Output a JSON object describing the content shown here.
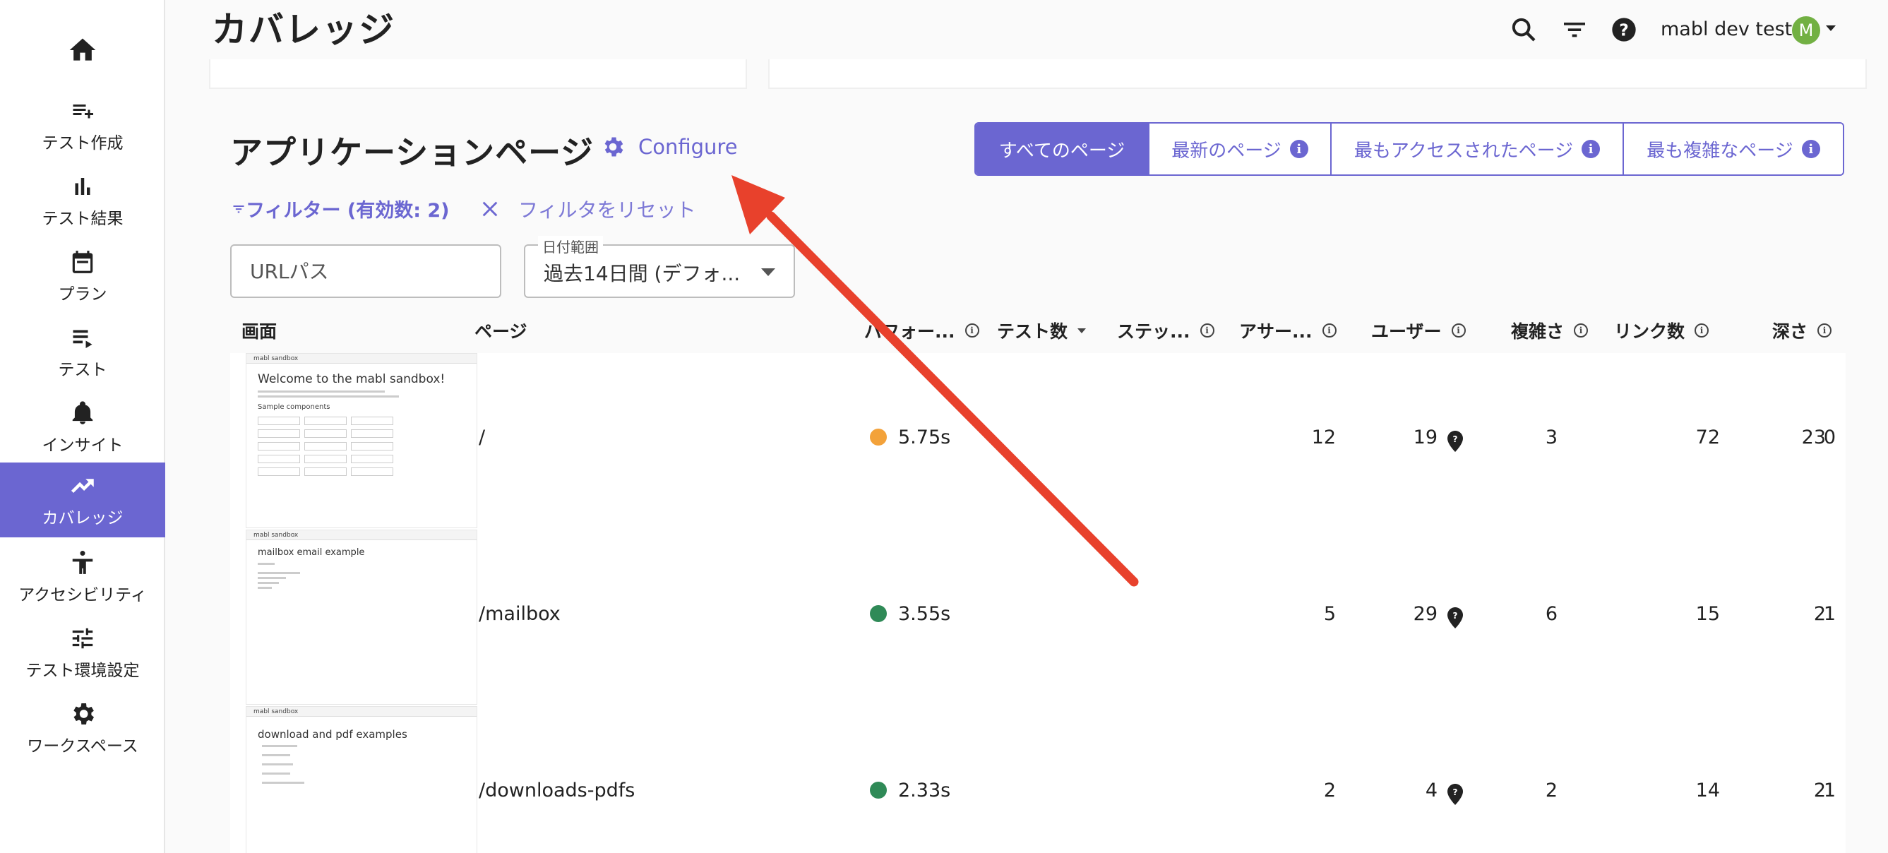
{
  "sidebar": {
    "items": [
      {
        "label": "",
        "icon": "home-icon"
      },
      {
        "label": "テスト作成",
        "icon": "playlist-add-icon"
      },
      {
        "label": "テスト結果",
        "icon": "bar-chart-icon"
      },
      {
        "label": "プラン",
        "icon": "calendar-icon"
      },
      {
        "label": "テスト",
        "icon": "list-icon"
      },
      {
        "label": "インサイト",
        "icon": "bell-icon"
      },
      {
        "label": "カバレッジ",
        "icon": "trending-up-icon"
      },
      {
        "label": "アクセシビリティ",
        "icon": "accessibility-icon"
      },
      {
        "label": "テスト環境設定",
        "icon": "tune-icon"
      },
      {
        "label": "ワークスペース",
        "icon": "gear-icon"
      }
    ],
    "active_index": 6,
    "accent": "#6b66d1"
  },
  "header": {
    "title": "カバレッジ",
    "workspace": "mabl dev tests",
    "avatar_letter": "M"
  },
  "section": {
    "title": "アプリケーションページ",
    "configure": "Configure",
    "tabs": [
      "すべてのページ",
      "最新のページ",
      "最もアクセスされたページ",
      "最も複雑なページ"
    ],
    "active_tab": 0
  },
  "filters": {
    "label": "フィルター (有効数: 2)",
    "reset": "フィルタをリセット",
    "url_placeholder": "URLパス",
    "date_label": "日付範囲",
    "date_value": "過去14日間 (デフォ..."
  },
  "table": {
    "columns": [
      "画面",
      "ページ",
      "パフォー...",
      "テスト数",
      "ステッ...",
      "アサー...",
      "ユーザー",
      "複雑さ",
      "リンク数",
      "深さ"
    ],
    "rows": [
      {
        "page": "/",
        "perf": "5.75s",
        "perf_color": "#f3a23a",
        "tests": "12",
        "steps": "19",
        "assertions": "3",
        "complexity": "72",
        "links": "23",
        "depth": "0",
        "thumb_title": "Welcome to the mabl sandbox!",
        "thumb_brand": "mabl sandbox",
        "thumb_subtitle": "Sample components"
      },
      {
        "page": "/mailbox",
        "perf": "3.55s",
        "perf_color": "#2f8a57",
        "tests": "5",
        "steps": "29",
        "assertions": "6",
        "complexity": "15",
        "links": "2",
        "depth": "1",
        "thumb_title": "mailbox email example",
        "thumb_brand": "mabl sandbox"
      },
      {
        "page": "/downloads-pdfs",
        "perf": "2.33s",
        "perf_color": "#2f8a57",
        "tests": "2",
        "steps": "4",
        "assertions": "2",
        "complexity": "14",
        "links": "2",
        "depth": "1",
        "thumb_title": "download and pdf examples",
        "thumb_brand": "mabl sandbox"
      }
    ]
  },
  "annotation": {
    "color": "#e8412c"
  }
}
